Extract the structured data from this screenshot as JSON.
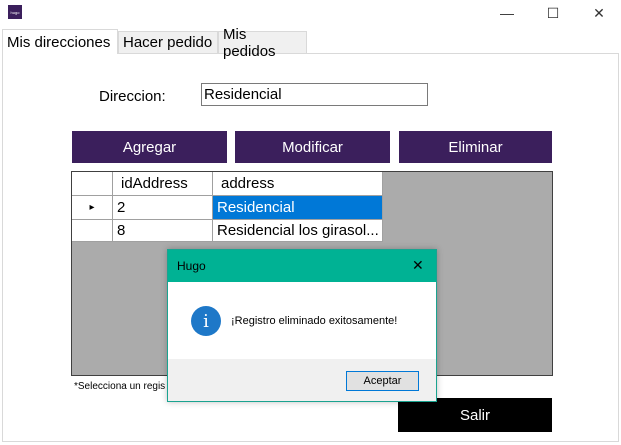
{
  "window": {
    "app_icon_text": "hugo",
    "minimize_glyph": "—",
    "maximize_glyph": "☐",
    "close_glyph": "✕"
  },
  "tabs": [
    {
      "label": "Mis direcciones",
      "active": true
    },
    {
      "label": "Hacer pedido",
      "active": false
    },
    {
      "label": "Mis pedidos",
      "active": false
    }
  ],
  "form": {
    "direccion_label": "Direccion:",
    "direccion_value": "Residencial"
  },
  "buttons": {
    "agregar": "Agregar",
    "modificar": "Modificar",
    "eliminar": "Eliminar",
    "salir": "Salir"
  },
  "grid": {
    "columns": [
      "idAddress",
      "address"
    ],
    "row_indicator": "▸",
    "rows": [
      {
        "idAddress": "2",
        "address": "Residencial",
        "selected": true
      },
      {
        "idAddress": "8",
        "address": "Residencial los girasol...",
        "selected": false
      }
    ]
  },
  "note": "*Selecciona un regis",
  "dialog": {
    "title": "Hugo",
    "close_glyph": "✕",
    "icon_glyph": "i",
    "message": "¡Registro eliminado exitosamente!",
    "accept_label": "Aceptar"
  },
  "colors": {
    "purple": "#3b1f5c",
    "dialog_title_bg": "#00b294",
    "selection": "#0078d7",
    "grid_bg": "#ababab"
  }
}
